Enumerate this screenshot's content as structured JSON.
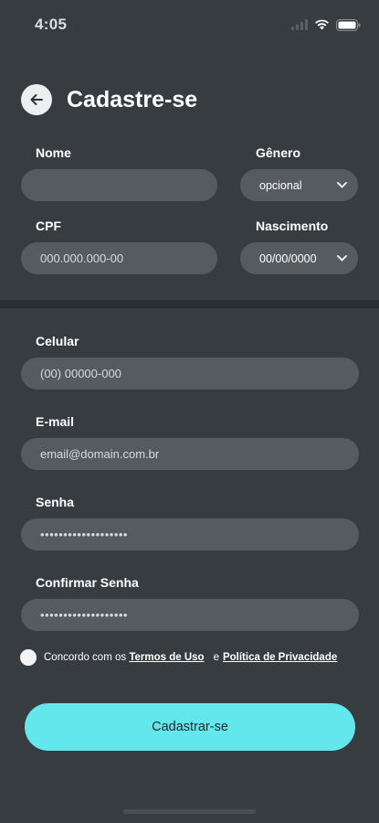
{
  "status_bar": {
    "time": "4:05"
  },
  "header": {
    "title": "Cadastre-se"
  },
  "form": {
    "nome": {
      "label": "Nome",
      "value": ""
    },
    "genero": {
      "label": "Gênero",
      "selected": "opcional"
    },
    "cpf": {
      "label": "CPF",
      "placeholder": "000.000.000-00"
    },
    "nascimento": {
      "label": "Nascimento",
      "selected": "00/00/0000"
    },
    "celular": {
      "label": "Celular",
      "placeholder": "(00) 00000-000"
    },
    "email": {
      "label": "E-mail",
      "placeholder": "email@domain.com.br"
    },
    "senha": {
      "label": "Senha",
      "value": "•••••••••••••••••••"
    },
    "confirmar_senha": {
      "label": "Confirmar Senha",
      "value": "•••••••••••••••••••"
    }
  },
  "terms": {
    "prefix": "Concordo com os ",
    "terms_link": "Termos de Uso",
    "joiner": "e",
    "privacy_link": "Política de Privacidade"
  },
  "submit_label": "Cadastrar-se",
  "colors": {
    "background": "#373c41",
    "field": "#565b60",
    "accent": "#63e6ec",
    "divider": "#2b2f33"
  },
  "icons": {
    "back": "arrow-left-icon",
    "dropdown": "chevron-down-icon",
    "signal": "signal-icon",
    "wifi": "wifi-icon",
    "battery": "battery-icon"
  }
}
